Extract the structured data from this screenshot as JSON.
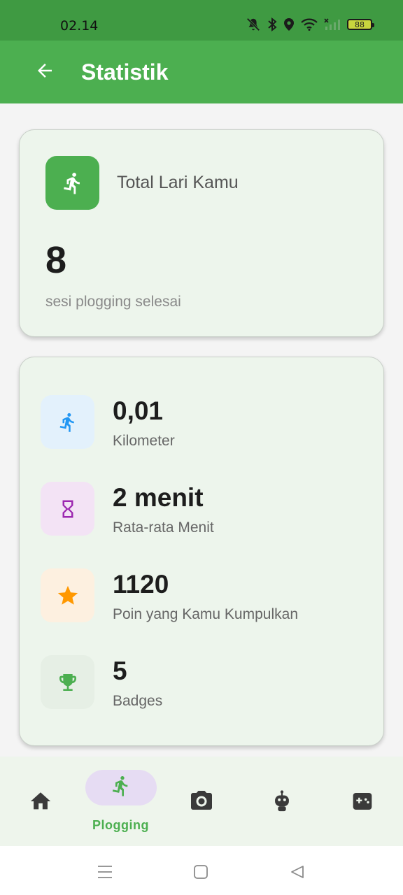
{
  "status_bar": {
    "time": "02.14",
    "battery": "88",
    "icons": [
      "mute-icon",
      "bluetooth-icon",
      "location-icon",
      "wifi-icon",
      "signal-icon",
      "battery-icon"
    ]
  },
  "app_bar": {
    "title": "Statistik",
    "back_icon": "arrow-left-icon",
    "color": "#4caf50"
  },
  "total_card": {
    "label": "Total Lari Kamu",
    "value": "8",
    "caption": "sesi plogging selesai",
    "icon": "running-icon"
  },
  "stats": [
    {
      "value": "0,01",
      "label": "Kilometer",
      "icon": "running-icon",
      "icon_color": "#2196f3",
      "bg": "#e3f1fc"
    },
    {
      "value": "2 menit",
      "label": "Rata-rata Menit",
      "icon": "hourglass-icon",
      "icon_color": "#9c27b0",
      "bg": "#f3e3f5"
    },
    {
      "value": "1120",
      "label": "Poin yang Kamu Kumpulkan",
      "icon": "star-icon",
      "icon_color": "#ff9800",
      "bg": "#fdf0e0"
    },
    {
      "value": "5",
      "label": "Badges",
      "icon": "trophy-icon",
      "icon_color": "#4caf50",
      "bg": "#e6efe5"
    }
  ],
  "bottom_nav": {
    "items": [
      {
        "name": "home",
        "icon": "home-icon",
        "label": ""
      },
      {
        "name": "plogging",
        "icon": "running-icon",
        "label": "Plogging",
        "active": true
      },
      {
        "name": "camera",
        "icon": "camera-icon",
        "label": ""
      },
      {
        "name": "robot",
        "icon": "robot-icon",
        "label": ""
      },
      {
        "name": "games",
        "icon": "gamepad-icon",
        "label": ""
      }
    ]
  },
  "system_nav": [
    "menu-icon",
    "home-square-icon",
    "back-triangle-icon"
  ]
}
